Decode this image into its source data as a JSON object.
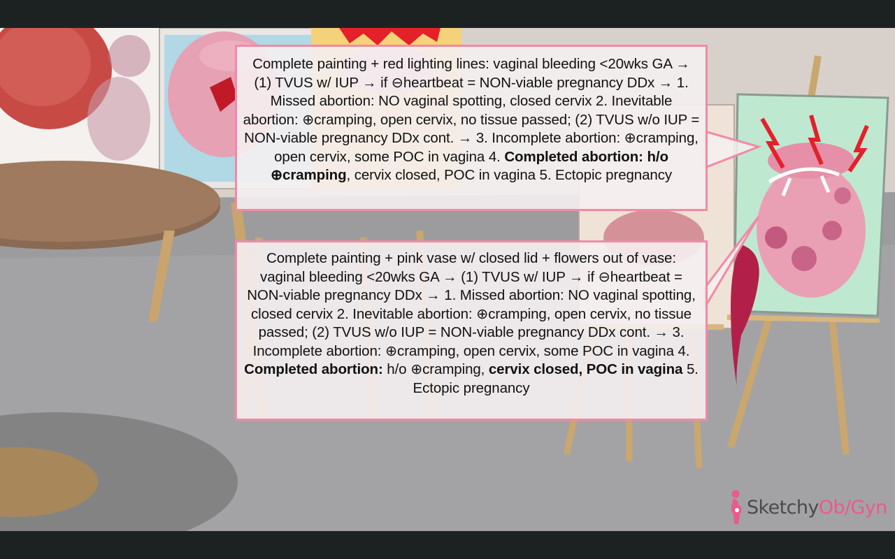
{
  "callout_top": {
    "p1": "Complete painting + red lighting lines: vaginal bleeding <20wks GA → (1) TVUS w/ IUP → if ⊖heartbeat = NON-viable pregnancy DDx → 1. Missed abortion: NO vaginal spotting, closed cervix 2. Inevitable abortion: ⊕cramping, open cervix, no tissue passed; (2)  TVUS w/o IUP = NON-viable pregnancy DDx cont. → 3. Incomplete abortion: ⊕cramping, open cervix, some POC in vagina 4. ",
    "bold": "Completed abortion: h/o ⊕cramping",
    "p2": ", cervix closed, POC in vagina 5. Ectopic pregnancy"
  },
  "callout_bottom": {
    "p1": "Complete painting + pink vase w/ closed lid + flowers out of vase: vaginal bleeding <20wks GA → (1) TVUS w/ IUP → if ⊖heartbeat = NON-viable pregnancy DDx → 1. Missed abortion: NO vaginal spotting, closed cervix 2. Inevitable abortion: ⊕cramping, open cervix, no tissue passed; (2) TVUS w/o IUP = NON-viable pregnancy DDx cont. → 3. Incomplete abortion: ⊕cramping, open cervix, some POC in vagina 4. ",
    "bold1": "Completed abortion:",
    "p2": " h/o ⊕cramping, ",
    "bold2": "cervix closed, POC in vagina",
    "p3": " 5. Ectopic pregnancy"
  },
  "logo": {
    "part1": "Sketchy",
    "part2": "Ob/Gyn"
  },
  "colors": {
    "callout_border": "#f08aa6",
    "wall": "#d8d1cb",
    "floor": "#9a9a9c",
    "logo_accent": "#ea5a8a",
    "canvas_green": "#bfe8d0",
    "vase_pink": "#eaa0b4",
    "lightning_red": "#e4202a"
  },
  "icons": {
    "logo": "pregnant-figure-icon"
  }
}
